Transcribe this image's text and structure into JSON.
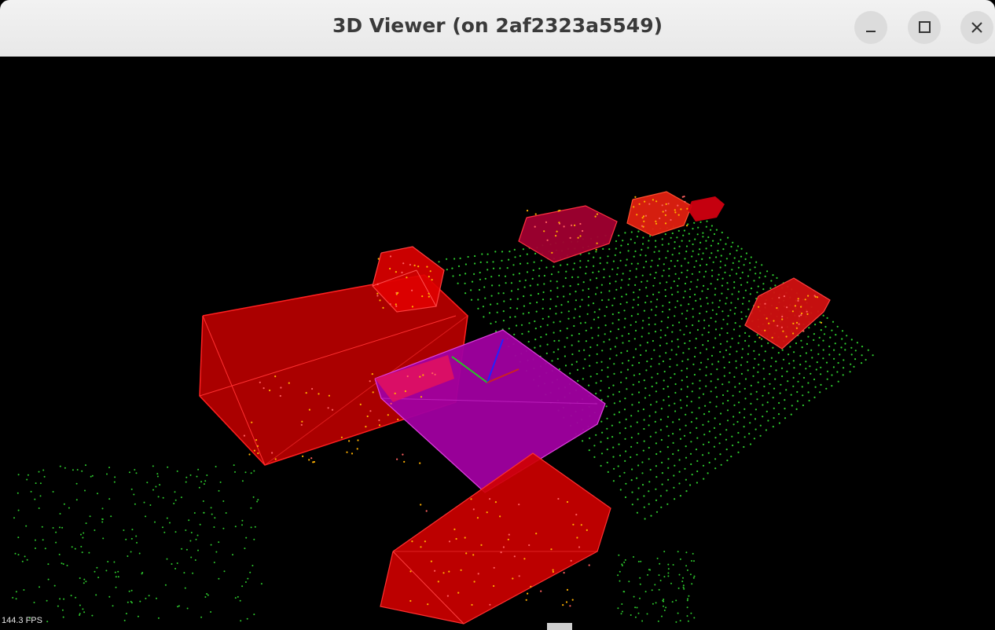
{
  "window": {
    "title": "3D Viewer (on 2af2323a5549)",
    "controls": [
      "minimize-icon",
      "maximize-icon",
      "close-icon"
    ]
  },
  "viewport": {
    "background": "#000000",
    "fps_label": "144.3 FPS",
    "colors": {
      "point_cloud": "#2ecc2e",
      "object_box": "#ff0000",
      "ego_box": "#cc00cc",
      "highlight_points": "#ffb000",
      "axis_x": "#cc2222",
      "axis_y": "#22cc22",
      "axis_z": "#2222ff"
    }
  }
}
